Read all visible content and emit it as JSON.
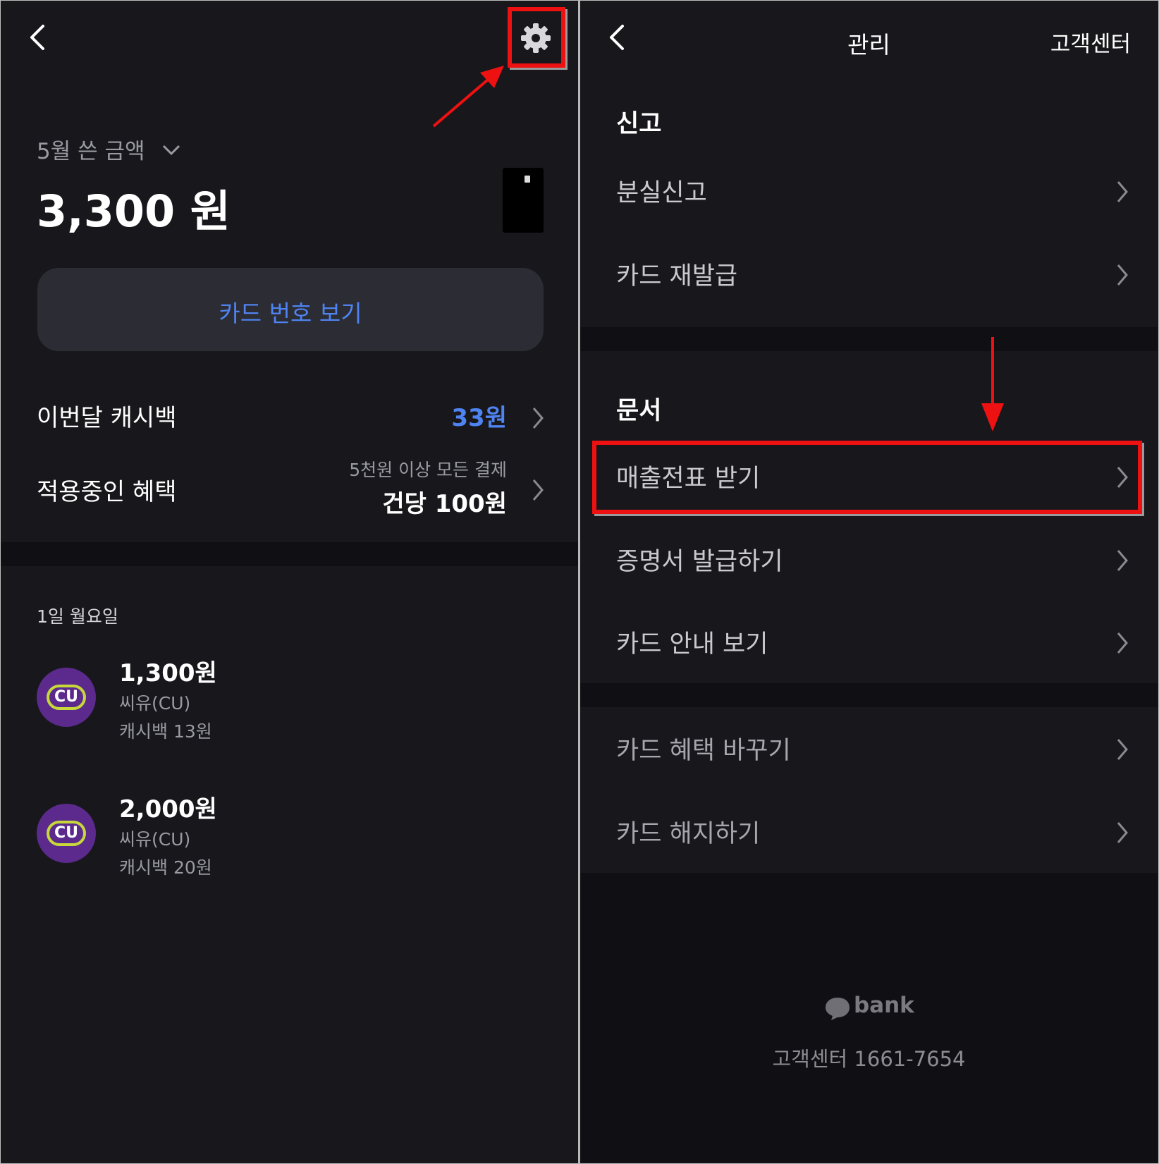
{
  "left": {
    "month_label": "5월 쓴 금액",
    "total_amount": "3,300 원",
    "view_card_number_button": "카드 번호 보기",
    "cashback_label": "이번달 캐시백",
    "cashback_value": "33원",
    "benefit_label": "적용중인 혜택",
    "benefit_condition": "5천원 이상 모든 결제",
    "benefit_value": "건당 100원",
    "date_header": "1일 월요일",
    "transactions": [
      {
        "logo": "CU",
        "amount": "1,300원",
        "merchant": "씨유(CU)",
        "cashback": "캐시백 13원"
      },
      {
        "logo": "CU",
        "amount": "2,000원",
        "merchant": "씨유(CU)",
        "cashback": "캐시백 20원"
      }
    ]
  },
  "right": {
    "title": "관리",
    "customer_center_button": "고객센터",
    "sections": {
      "report_title": "신고",
      "report_items": [
        "분실신고",
        "카드 재발급"
      ],
      "document_title": "문서",
      "document_items": [
        "매출전표 받기",
        "증명서 발급하기",
        "카드 안내 보기"
      ],
      "other_items": [
        "카드 혜택 바꾸기",
        "카드 해지하기"
      ]
    },
    "footer_brand": "bank",
    "footer_phone": "고객센터 1661-7654"
  },
  "colors": {
    "background": "#17171c",
    "accent_blue": "#4f83f0",
    "annotation_red": "#ee1111",
    "cu_purple": "#5b2a8c",
    "cu_yellow": "#c6d83a"
  }
}
